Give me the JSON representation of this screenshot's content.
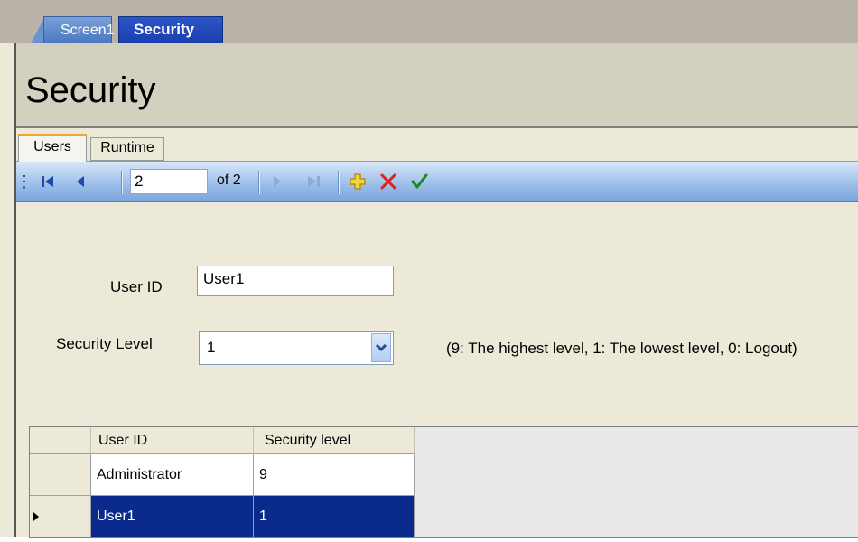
{
  "window": {
    "doc_tabs": [
      {
        "label": "Screen1",
        "active": false
      },
      {
        "label": "Security",
        "active": true
      }
    ]
  },
  "page": {
    "title": "Security"
  },
  "tabs": [
    {
      "label": "Users",
      "active": true
    },
    {
      "label": "Runtime",
      "active": false
    }
  ],
  "toolbar": {
    "current_record": "2",
    "of_label": "of 2",
    "icons": [
      "first-record-icon",
      "previous-record-icon",
      "next-record-icon",
      "last-record-icon",
      "add-icon",
      "delete-icon",
      "save-icon"
    ],
    "colors": {
      "add": "#e8b800",
      "delete": "#e02020",
      "save": "#1a8a1a",
      "nav": "#1d4aa8"
    }
  },
  "form": {
    "user_id_label": "User ID",
    "user_id_value": "User1",
    "security_level_label": "Security Level",
    "security_level_value": "1",
    "security_level_hint": "(9: The highest level, 1: The lowest level, 0: Logout)"
  },
  "grid": {
    "columns": [
      "User ID",
      "Security level"
    ],
    "rows": [
      {
        "user_id": "Administrator",
        "level": "9",
        "selected": false
      },
      {
        "user_id": "User1",
        "level": "1",
        "selected": true
      }
    ],
    "selection_color": "#0a2a8c"
  }
}
